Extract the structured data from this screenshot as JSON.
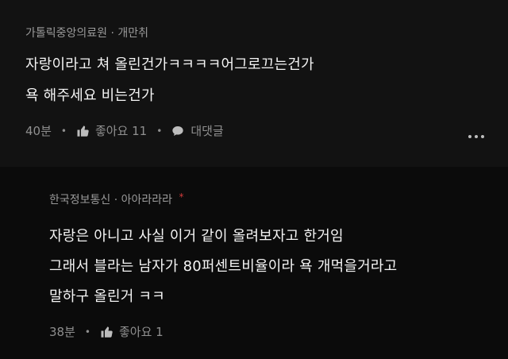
{
  "comment1": {
    "author": "가톨릭중앙의료원",
    "separator": "·",
    "target": "개만취",
    "lines": [
      "자랑이라고 쳐 올린건가ㅋㅋㅋㅋ어그로끄는건가",
      "욕 해주세요 비는건가"
    ],
    "time": "40분",
    "like_label": "좋아요 11",
    "reply_label": "대댓글",
    "like_icon": "thumbs-up-icon",
    "reply_icon": "speech-bubble-icon",
    "more_icon": "more-horizontal-icon"
  },
  "comment2": {
    "author": "한국정보통신",
    "separator": "·",
    "target": "아아라라라",
    "star": "*",
    "lines": [
      "자랑은 아니고 사실 이거 같이 올려보자고 한거임",
      "그래서 블라는 남자가 80퍼센트비율이라 욕 개먹을거라고",
      "말하구 올린거 ㅋㅋ"
    ],
    "time": "38분",
    "like_label": "좋아요 1",
    "like_icon": "thumbs-up-icon"
  },
  "colors": {
    "background": "#121212",
    "reply_background": "#0b0b0b",
    "text": "#f4f4f4",
    "muted": "#9a9a9a",
    "accent_star": "#d23b3b"
  }
}
